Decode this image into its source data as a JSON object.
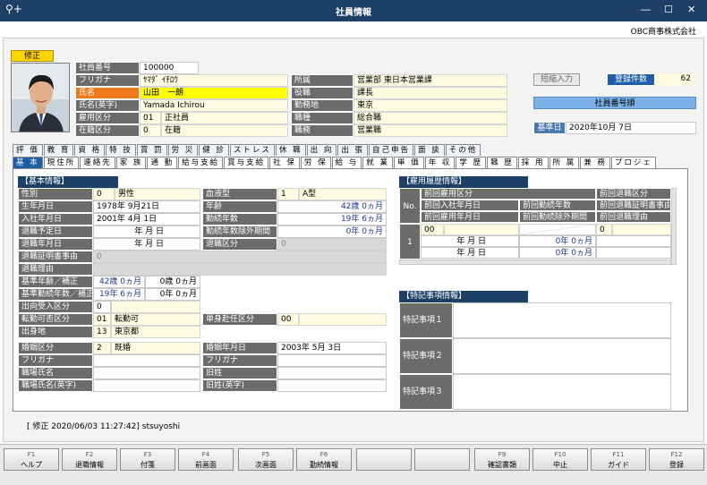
{
  "window": {
    "title": "社員情報",
    "company": "OBC商事株式会社"
  },
  "mode_badge": "修正",
  "header_left": [
    {
      "label": "社員番号",
      "value": "100000"
    },
    {
      "label": "フリガナ",
      "value": "ﾔﾏﾀﾞ ｲﾁﾛｳ"
    },
    {
      "label": "氏名",
      "value": "山田　一朗"
    },
    {
      "label": "氏名(英字)",
      "value": "Yamada Ichirou"
    },
    {
      "label": "雇用区分",
      "code": "01",
      "value": "正社員"
    },
    {
      "label": "在籍区分",
      "code": "0",
      "value": "在籍"
    }
  ],
  "header_right": [
    {
      "label": "所属",
      "value": "営業部 東日本営業課"
    },
    {
      "label": "役職",
      "value": "課長"
    },
    {
      "label": "勤務地",
      "value": "東京"
    },
    {
      "label": "職種",
      "value": "総合職"
    },
    {
      "label": "職務",
      "value": "営業職"
    }
  ],
  "side": {
    "shorten_btn": "短縮入力",
    "count_label": "登録件数",
    "count_value": "62",
    "sort_order": "社員番号順",
    "base_date_label": "基準日",
    "base_date_value": "2020年10月 7日"
  },
  "tabs_row1": [
    "評 価",
    "教 育",
    "資 格",
    "特 技",
    "賞 罰",
    "労 災",
    "健 診",
    "ストレス",
    "休 職",
    "出 向",
    "出 張",
    "自己申告",
    "面 談",
    "その他"
  ],
  "tabs_row2": [
    "基 本",
    "現住所",
    "連絡先",
    "家 族",
    "通 勤",
    "給与支給",
    "賞与支給",
    "社 保",
    "労 保",
    "給 与",
    "就 業",
    "単 価",
    "年 収",
    "学 歴",
    "職 歴",
    "採 用",
    "所 属",
    "兼 務",
    "プロジェ"
  ],
  "basic": {
    "section_title": "【基本情報】",
    "gender": {
      "label": "性別",
      "code": "0",
      "value": "男性"
    },
    "blood": {
      "label": "血液型",
      "code": "1",
      "value": "A型"
    },
    "birth": {
      "label": "生年月日",
      "value": "1978年 9月21日"
    },
    "age": {
      "label": "年齢",
      "value": "42歳  0ヵ月"
    },
    "join": {
      "label": "入社年月日",
      "value": "2001年 4月 1日"
    },
    "tenure": {
      "label": "勤続年数",
      "value": "19年  6ヵ月"
    },
    "retire_plan": {
      "label": "退職予定日",
      "value": "年   月   日"
    },
    "tenure_excl": {
      "label": "勤続年数除外期間",
      "value": "0年  0ヵ月"
    },
    "retire_date": {
      "label": "退職年月日",
      "value": "年   月   日"
    },
    "retire_type": {
      "label": "退職区分",
      "code": "0"
    },
    "retire_cert": {
      "label": "退職証明書事由",
      "code": "0"
    },
    "retire_reason": {
      "label": "退職理由"
    },
    "base_age": {
      "label": "基準年齢／補正",
      "v1": "42歳  0ヵ月",
      "v2": "0歳  0ヵ月"
    },
    "base_tenure": {
      "label": "基準勤続年数／補正",
      "v1": "19年  6ヵ月",
      "v2": "0年  0ヵ月"
    },
    "loan_type": {
      "label": "出向受入区分",
      "code": "0"
    },
    "transfer": {
      "label": "転勤可否区分",
      "code": "01",
      "value": "転勤可"
    },
    "single": {
      "label": "単身赴任区分",
      "code": "00"
    },
    "origin": {
      "label": "出身地",
      "code": "13",
      "value": "東京都"
    },
    "marriage": {
      "label": "婚姻区分",
      "code": "2",
      "value": "既婚"
    },
    "marriage_date": {
      "label": "婚姻年月日",
      "value": "2003年  5月  3日"
    },
    "furigana1": {
      "label": "フリガナ"
    },
    "furigana2": {
      "label": "フリガナ"
    },
    "work_name": {
      "label": "職場氏名"
    },
    "old_name": {
      "label": "旧姓"
    },
    "work_name_en": {
      "label": "職場氏名(英字)"
    },
    "old_name_en": {
      "label": "旧姓(英字)"
    }
  },
  "employment": {
    "section_title": "【雇用履歴情報】",
    "no_label": "No.",
    "headers": [
      "前回雇用区分",
      "前回入社年月日",
      "前回勤続年数",
      "前回雇用年月日",
      "前回勤続除外期間",
      "前回退職区分",
      "前回退職証明書事由",
      "前回退職理由"
    ],
    "row_no": "1",
    "row": {
      "emp_code": "00",
      "join": "年   月   日",
      "tenure": "0年  0ヵ月",
      "retire": "年   月   日",
      "excl": "0年  0ヵ月",
      "retire_code": "0"
    }
  },
  "special": {
    "section_title": "【特記事項情報】",
    "items": [
      "特記事項１",
      "特記事項２",
      "特記事項３"
    ]
  },
  "status": "[ 修正  2020/06/03 11:27:42]  stsuyoshi",
  "fkeys": [
    {
      "key": "F1",
      "label": "ヘルプ"
    },
    {
      "key": "F2",
      "label": "退職情報"
    },
    {
      "key": "F3",
      "label": "付箋"
    },
    {
      "key": "F4",
      "label": "前画面"
    },
    {
      "key": "F5",
      "label": "次画面"
    },
    {
      "key": "F6",
      "label": "勤続情報"
    },
    {
      "key": "",
      "label": ""
    },
    {
      "key": "",
      "label": ""
    },
    {
      "key": "F9",
      "label": "確認書類"
    },
    {
      "key": "F10",
      "label": "中止"
    },
    {
      "key": "F11",
      "label": "ガイド"
    },
    {
      "key": "F12",
      "label": "登録"
    }
  ]
}
